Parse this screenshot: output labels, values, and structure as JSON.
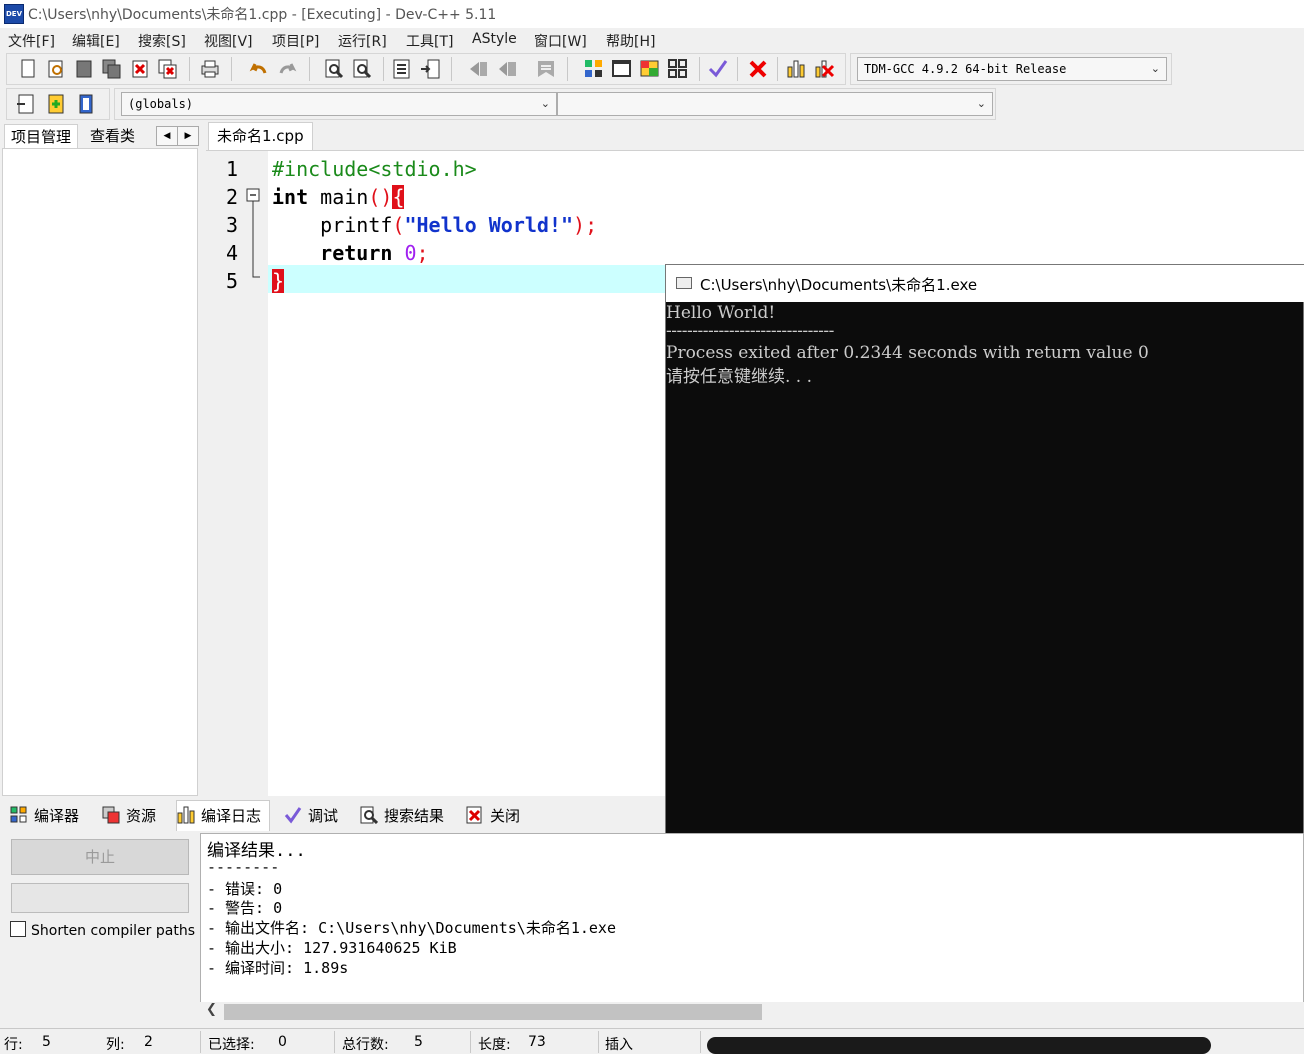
{
  "window": {
    "title": "C:\\Users\\nhy\\Documents\\未命名1.cpp - [Executing] - Dev-C++ 5.11",
    "icon_text": "DEV"
  },
  "menu": [
    "文件[F]",
    "编辑[E]",
    "搜索[S]",
    "视图[V]",
    "项目[P]",
    "运行[R]",
    "工具[T]",
    "AStyle",
    "窗口[W]",
    "帮助[H]"
  ],
  "toolbar": {
    "compiler_select": "TDM-GCC 4.9.2 64-bit Release",
    "scope_select": "(globals)",
    "symbol_select": ""
  },
  "left_tabs": [
    "项目管理",
    "查看类"
  ],
  "editor": {
    "tab": "未命名1.cpp",
    "lines": [
      "1",
      "2",
      "3",
      "4",
      "5"
    ]
  },
  "console": {
    "title": "C:\\Users\\nhy\\Documents\\未命名1.exe",
    "lines": [
      "Hello World!",
      "--------------------------------",
      "Process exited after 0.2344 seconds with return value 0",
      "请按任意键继续. . ."
    ]
  },
  "bottom_tabs": [
    "编译器",
    "资源",
    "编译日志",
    "调试",
    "搜索结果",
    "关闭"
  ],
  "compile": {
    "abort_label": "中止",
    "shorten_label": "Shorten compiler paths",
    "log": [
      "编译结果...",
      "--------",
      "- 错误: 0",
      "- 警告: 0",
      "- 输出文件名: C:\\Users\\nhy\\Documents\\未命名1.exe",
      "- 输出大小: 127.931640625 KiB",
      "- 编译时间: 1.89s"
    ]
  },
  "status": {
    "row_label": "行:",
    "row": "5",
    "col_label": "列:",
    "col": "2",
    "sel_label": "已选择:",
    "sel": "0",
    "total_label": "总行数:",
    "total": "5",
    "len_label": "长度:",
    "len": "73",
    "mode": "插入"
  },
  "colors": {
    "current_line": "#ccffff",
    "brace_match": "#e0101a",
    "string": "#1133cc",
    "preprocessor": "#1a8a1a",
    "number": "#a020f0"
  }
}
